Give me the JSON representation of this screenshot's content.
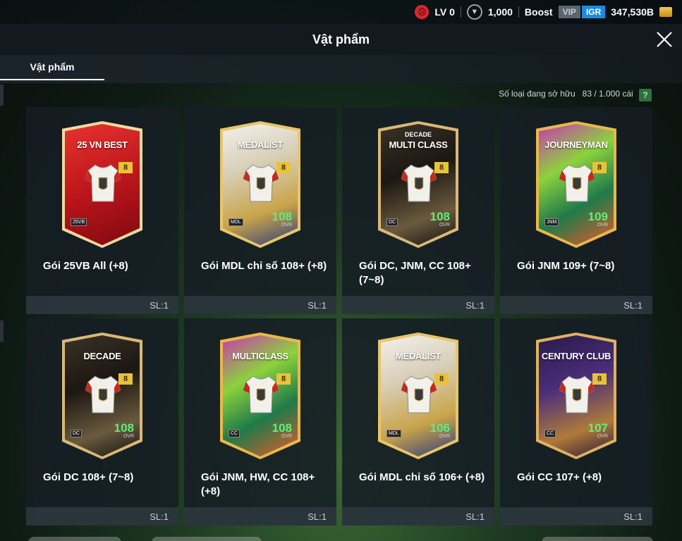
{
  "topbar": {
    "level": "LV 0",
    "coins": "1,000",
    "boost": "Boost",
    "vip": "VIP",
    "igr": "IGR",
    "bp": "347,530B"
  },
  "header": {
    "title": "Vật phẩm"
  },
  "tabs": [
    {
      "label": "Vật phẩm"
    }
  ],
  "owned": {
    "label": "Số loại đang sở hữu",
    "value": "83 / 1.000 cái",
    "help": "?"
  },
  "items": [
    {
      "name": "Gói 25VB All (+8)",
      "qty": "SL:1",
      "card_title": "25 VN BEST",
      "card_sub": "",
      "level": "8",
      "ovr": "",
      "ovr_label": "",
      "badge": "25VB",
      "theme": "red"
    },
    {
      "name": "Gói MDL chỉ số 108+ (+8)",
      "qty": "SL:1",
      "card_title": "MEDALIST",
      "card_sub": "",
      "level": "8",
      "ovr": "108",
      "ovr_label": "OVR",
      "badge": "MDL",
      "theme": "medalist"
    },
    {
      "name": "Gói DC, JNM, CC 108+ (7~8)",
      "qty": "SL:1",
      "card_title": "MULTI CLASS",
      "card_sub": "DECADE",
      "level": "8",
      "ovr": "108",
      "ovr_label": "OVR",
      "badge": "DC",
      "theme": "decade"
    },
    {
      "name": "Gói JNM 109+ (7~8)",
      "qty": "SL:1",
      "card_title": "JOURNEYMAN",
      "card_sub": "",
      "level": "8",
      "ovr": "109",
      "ovr_label": "OVR",
      "badge": "JNM",
      "theme": "journeyman"
    },
    {
      "name": "Gói DC 108+ (7~8)",
      "qty": "SL:1",
      "card_title": "DECADE",
      "card_sub": "",
      "level": "8",
      "ovr": "108",
      "ovr_label": "OVR",
      "badge": "DC",
      "theme": "decade"
    },
    {
      "name": "Gói JNM, HW, CC 108+ (+8)",
      "qty": "SL:1",
      "card_title": "MULTICLASS",
      "card_sub": "",
      "level": "8",
      "ovr": "108",
      "ovr_label": "OVR",
      "badge": "CC",
      "theme": "journeyman"
    },
    {
      "name": "Gói MDL chỉ số 106+ (+8)",
      "qty": "SL:1",
      "card_title": "MEDALIST",
      "card_sub": "",
      "level": "8",
      "ovr": "106",
      "ovr_label": "OVR",
      "badge": "MDL",
      "theme": "medalist"
    },
    {
      "name": "Gói CC 107+ (+8)",
      "qty": "SL:1",
      "card_title": "CENTURY CLUB",
      "card_sub": "",
      "level": "8",
      "ovr": "107",
      "ovr_label": "OVR",
      "badge": "CC",
      "theme": "century"
    }
  ],
  "colors": {
    "accent_green": "#5cf07a",
    "level_gold": "#e9c23b",
    "igr_blue": "#1d8be0"
  }
}
